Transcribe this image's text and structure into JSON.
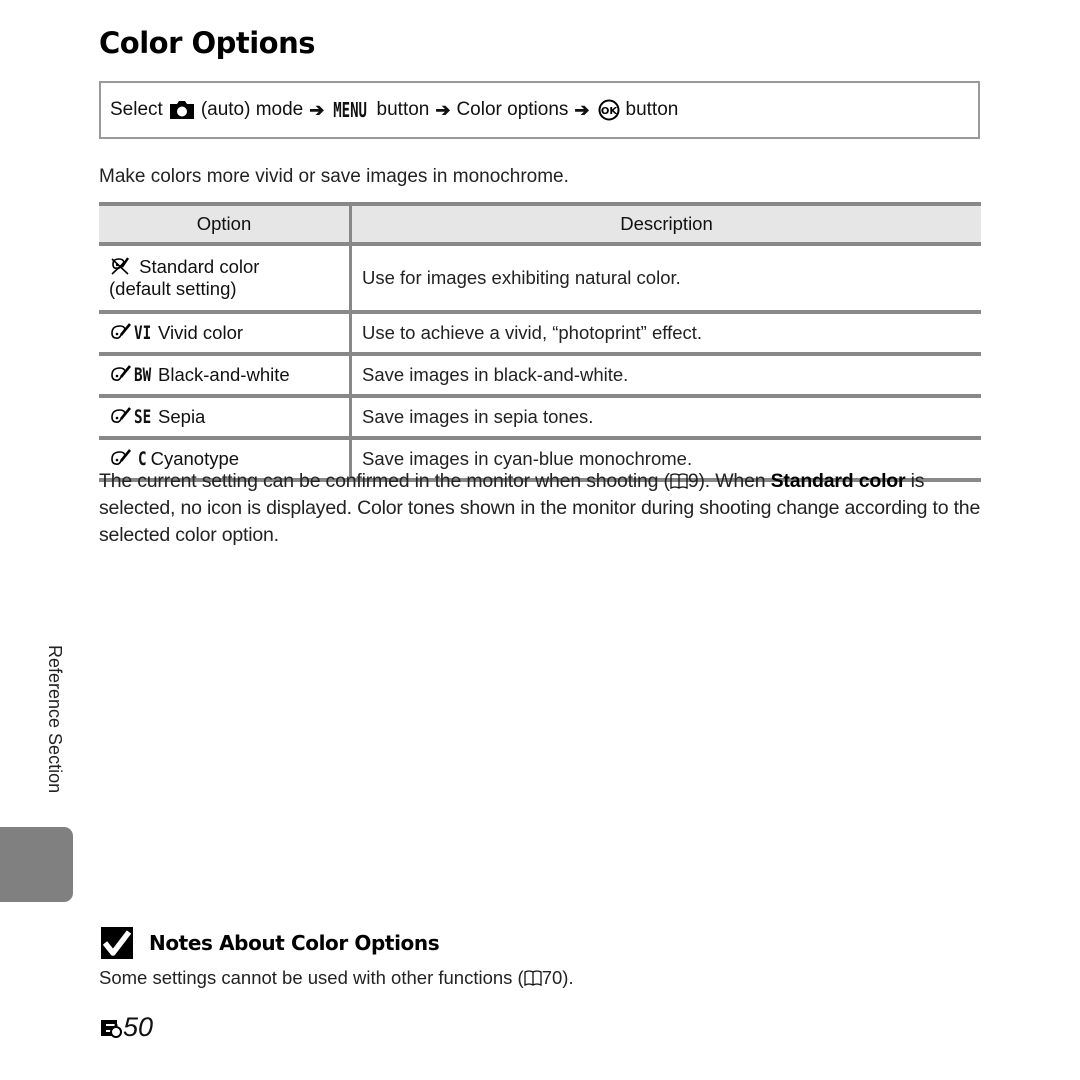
{
  "page": {
    "title": "Color Options",
    "nav_path": {
      "select": "Select",
      "mode_icon": "camera-auto-icon",
      "mode": "(auto) mode",
      "arrow": "➔",
      "menu_glyph": "MENU",
      "menu_suffix": "button",
      "step3": "Color options",
      "ok_icon": "ok-button-icon",
      "ok_suffix": "button"
    },
    "intro": "Make colors more vivid or save images in monochrome.",
    "table": {
      "headers": [
        "Option",
        "Description"
      ],
      "rows": [
        {
          "icon": "standard-color-icon",
          "code": "",
          "label": "Standard color",
          "sublabel": "(default setting)",
          "description": "Use for images exhibiting natural color."
        },
        {
          "icon": "palette-brush-icon",
          "code": "VI",
          "label": "Vivid color",
          "description": "Use to achieve a vivid, “photoprint” effect."
        },
        {
          "icon": "palette-brush-icon",
          "code": "BW",
          "label": "Black-and-white",
          "description": "Save images in black-and-white."
        },
        {
          "icon": "palette-brush-icon",
          "code": "SE",
          "label": "Sepia",
          "description": "Save images in sepia tones."
        },
        {
          "icon": "palette-brush-icon",
          "code": "C",
          "label": "Cyanotype",
          "description": "Save images in cyan-blue monochrome."
        }
      ]
    },
    "body": {
      "part1": "The current setting can be confirmed in the monitor when shooting (",
      "ref1": "9",
      "part2": "). When ",
      "bold": "Standard color",
      "part3": " is selected, no icon is displayed. Color tones shown in the monitor during shooting change according to the selected color option."
    },
    "side_label": "Reference Section",
    "notes": {
      "title": "Notes About Color Options",
      "text_before": "Some settings cannot be used with other functions (",
      "ref": "70",
      "text_after": ")."
    },
    "page_number": "50",
    "colors": {
      "rule": "#888888",
      "header_bg": "#e6e6e6",
      "side_tab": "#808080",
      "nav_border": "#9a9a9a"
    }
  }
}
